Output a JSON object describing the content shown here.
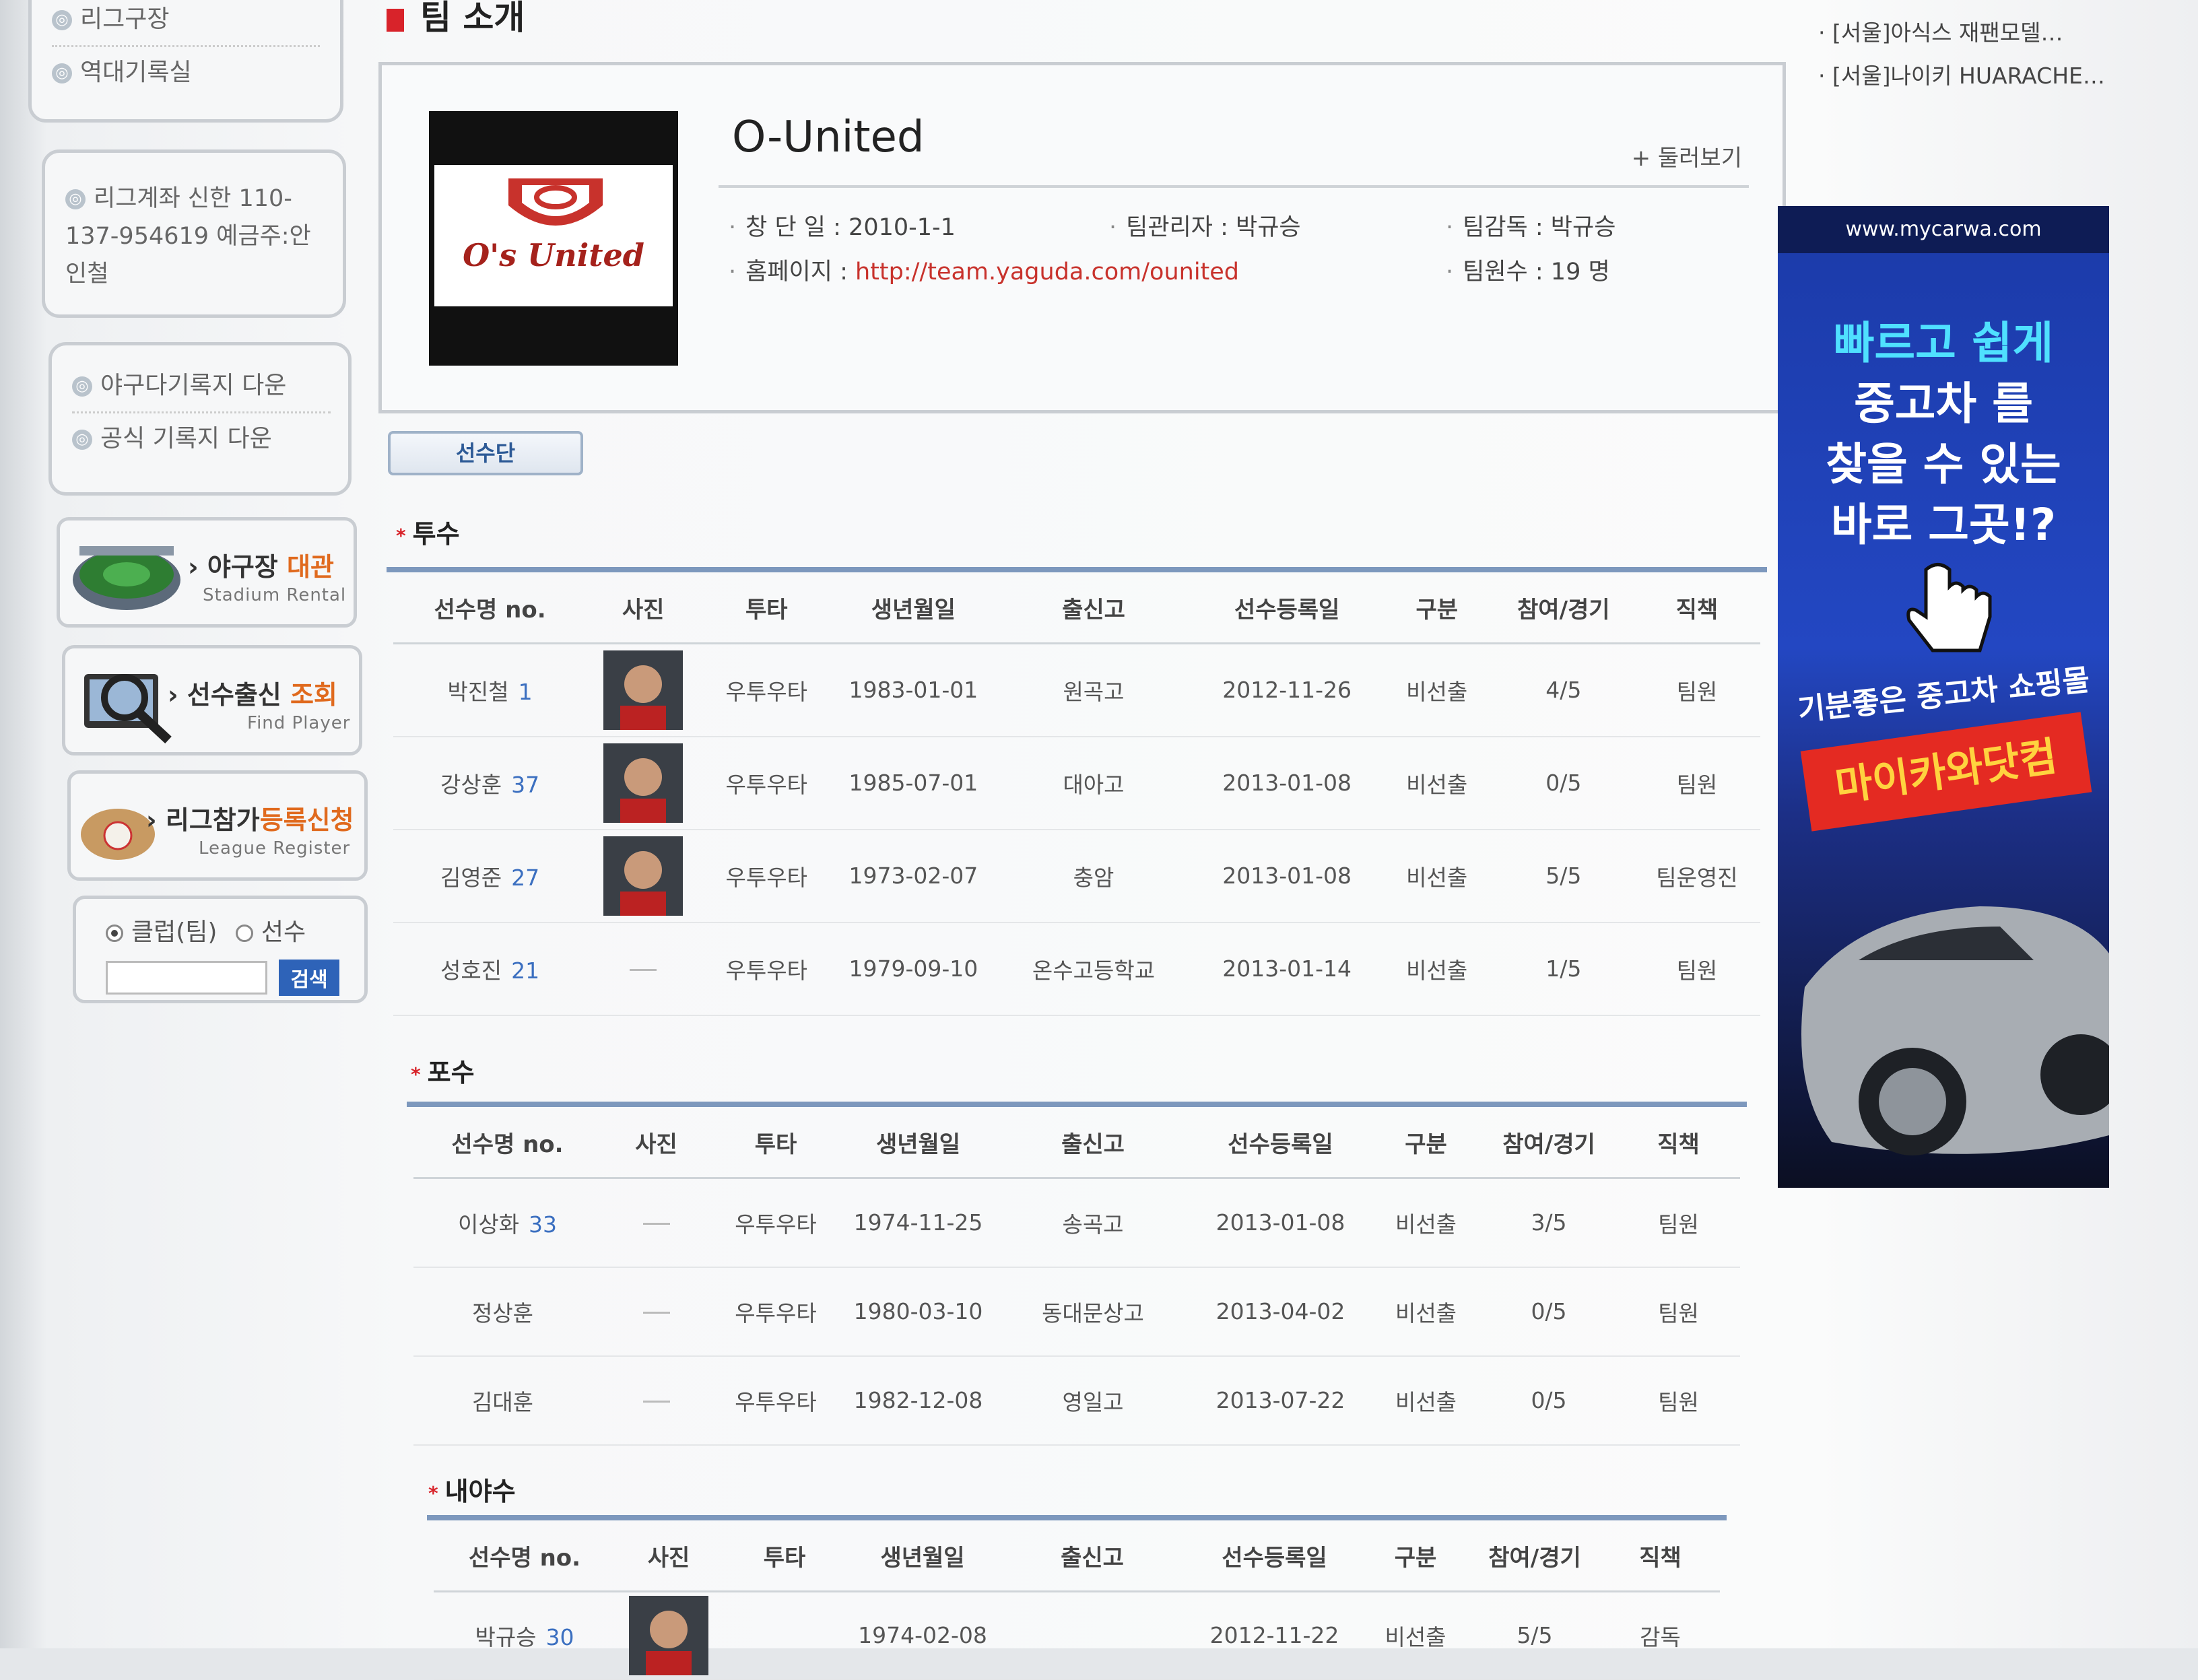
{
  "sidebar": {
    "top_links": [
      "리그구장",
      "역대기록실"
    ],
    "account_text": "리그계좌 신한 110-137-954619 예금주:안인철",
    "downloads": [
      "야구다기록지 다운",
      "공식 기록지 다운"
    ],
    "stadium": {
      "title": "야구장 ",
      "highlight": "대관",
      "sub": "Stadium Rental"
    },
    "find_player": {
      "title": "선수출신 ",
      "highlight": "조회",
      "sub": "Find Player"
    },
    "league_register": {
      "title": "리그참가",
      "highlight": "등록신청",
      "sub": "League Register"
    },
    "search": {
      "radio_club": "클럽(팀)",
      "radio_player": "선수",
      "button": "검색",
      "value": ""
    }
  },
  "header": {
    "title": "팀 소개"
  },
  "team": {
    "name": "O-United",
    "browse": "+ 둘러보기",
    "logo_text": "O's United",
    "founded_label": "창 단 일",
    "founded": "2010-1-1",
    "manager_label": "팀관리자",
    "manager": "박규승",
    "coach_label": "팀감독",
    "coach": "박규승",
    "homepage_label": "홈페이지",
    "homepage": "http://team.yaguda.com/ounited",
    "members_label": "팀원수",
    "members": "19 명"
  },
  "tab": {
    "label": "선수단"
  },
  "columns": [
    "선수명 no.",
    "사진",
    "투타",
    "생년월일",
    "출신고",
    "선수등록일",
    "구분",
    "참여/경기",
    "직책"
  ],
  "sections": [
    {
      "label": "투수",
      "rows": [
        {
          "name": "박진철",
          "no": "1",
          "photo": true,
          "bt": "우투우타",
          "birth": "1983-01-01",
          "school": "원곡고",
          "reg": "2012-11-26",
          "type": "비선출",
          "games": "4/5",
          "role": "팀원"
        },
        {
          "name": "강상훈",
          "no": "37",
          "photo": true,
          "bt": "우투우타",
          "birth": "1985-07-01",
          "school": "대아고",
          "reg": "2013-01-08",
          "type": "비선출",
          "games": "0/5",
          "role": "팀원"
        },
        {
          "name": "김영준",
          "no": "27",
          "photo": true,
          "bt": "우투우타",
          "birth": "1973-02-07",
          "school": "충암",
          "reg": "2013-01-08",
          "type": "비선출",
          "games": "5/5",
          "role": "팀운영진"
        },
        {
          "name": "성호진",
          "no": "21",
          "photo": false,
          "bt": "우투우타",
          "birth": "1979-09-10",
          "school": "온수고등학교",
          "reg": "2013-01-14",
          "type": "비선출",
          "games": "1/5",
          "role": "팀원"
        }
      ]
    },
    {
      "label": "포수",
      "rows": [
        {
          "name": "이상화",
          "no": "33",
          "photo": false,
          "bt": "우투우타",
          "birth": "1974-11-25",
          "school": "송곡고",
          "reg": "2013-01-08",
          "type": "비선출",
          "games": "3/5",
          "role": "팀원"
        },
        {
          "name": "정상훈",
          "no": "",
          "photo": false,
          "bt": "우투우타",
          "birth": "1980-03-10",
          "school": "동대문상고",
          "reg": "2013-04-02",
          "type": "비선출",
          "games": "0/5",
          "role": "팀원"
        },
        {
          "name": "김대훈",
          "no": "",
          "photo": false,
          "bt": "우투우타",
          "birth": "1982-12-08",
          "school": "영일고",
          "reg": "2013-07-22",
          "type": "비선출",
          "games": "0/5",
          "role": "팀원"
        }
      ]
    },
    {
      "label": "내야수",
      "rows": [
        {
          "name": "박규승",
          "no": "30",
          "photo": true,
          "bt": "",
          "birth": "1974-02-08",
          "school": "",
          "reg": "2012-11-22",
          "type": "비선출",
          "games": "5/5",
          "role": "감독"
        }
      ]
    }
  ],
  "news": [
    "[서울]아식스 재팬모델…",
    "[서울]나이키 HUARACHE…"
  ],
  "ad": {
    "url": "www.mycarwa.com",
    "lines": [
      "빠르고 쉽게",
      "중고차 를",
      "찾을 수 있는",
      "바로 그곳!?"
    ],
    "tagline": "기분좋은 중고차 쇼핑몰",
    "brand": "마이카와닷컴"
  },
  "colors": {
    "accent_red": "#d8232a",
    "link_blue": "#3b6fc0",
    "rule_blue": "#7d98bd",
    "orange": "#e06a1e"
  }
}
